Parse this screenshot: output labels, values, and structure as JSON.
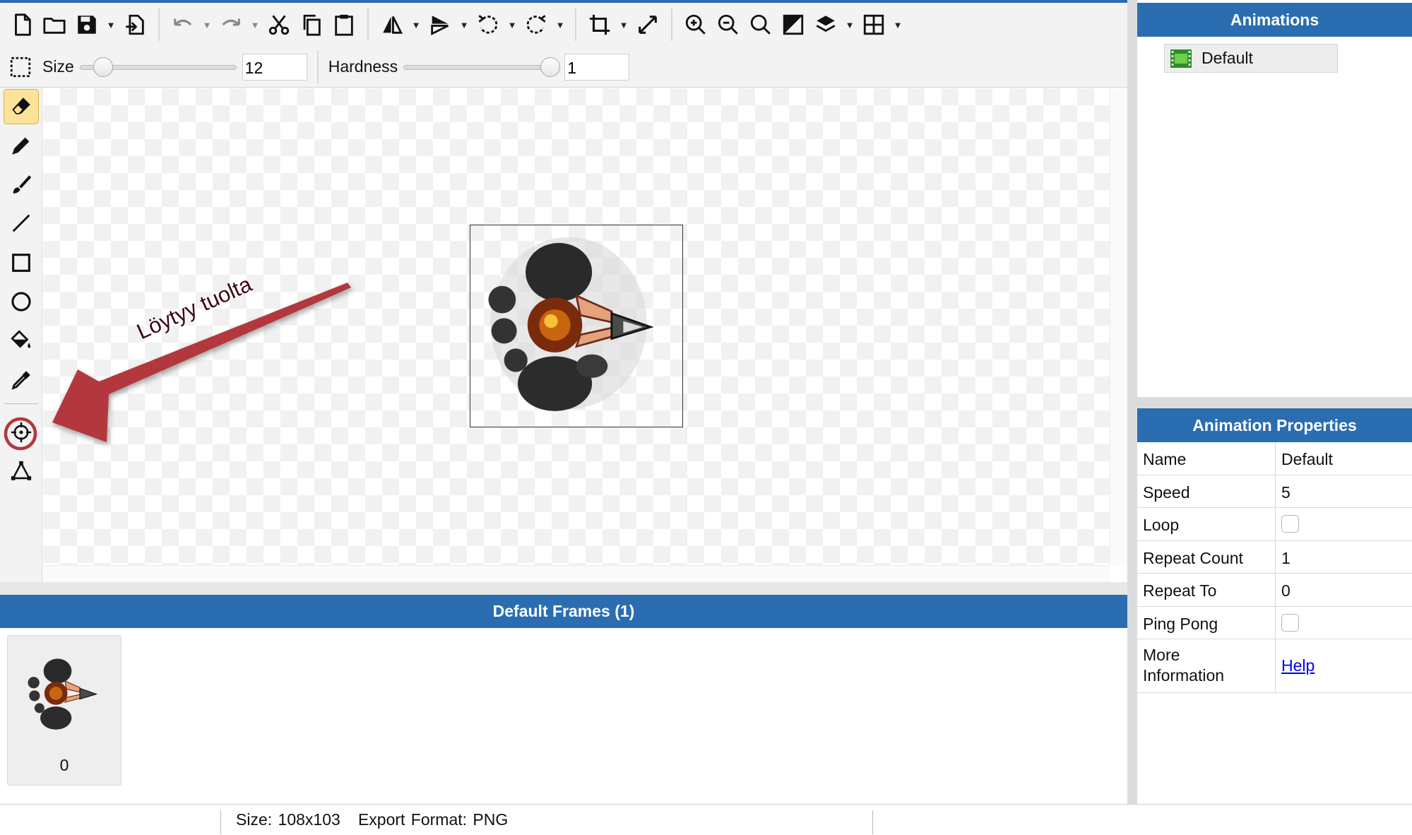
{
  "toolbar": {
    "buttons": [
      "new-file-icon",
      "open-folder-icon",
      "save-icon",
      "export-icon",
      "undo-icon",
      "redo-icon",
      "cut-icon",
      "copy-icon",
      "paste-icon",
      "flip-horizontal-icon",
      "flip-vertical-icon",
      "rotate-left-icon",
      "rotate-right-icon",
      "crop-icon",
      "resize-icon",
      "zoom-in-icon",
      "zoom-out-icon",
      "zoom-fit-icon",
      "contrast-icon",
      "layers-icon",
      "grid-icon"
    ]
  },
  "brush": {
    "size_label": "Size",
    "size_value": "12",
    "size_fraction": 0.1,
    "hardness_label": "Hardness",
    "hardness_value": "1",
    "hardness_fraction": 1.0
  },
  "tools": [
    "eraser-icon",
    "pencil-icon",
    "brush-icon",
    "line-icon",
    "rectangle-icon",
    "ellipse-icon",
    "fill-bucket-icon",
    "eyedropper-icon",
    "origin-point-icon",
    "polygon-points-icon"
  ],
  "active_tool": "eraser-icon",
  "annotation": {
    "text": "Löytyy tuolta",
    "color": "#b3383e"
  },
  "frames": {
    "header": "Default Frames (1)",
    "items": [
      {
        "index": "0"
      }
    ]
  },
  "animations": {
    "header": "Animations",
    "items": [
      {
        "name": "Default"
      }
    ]
  },
  "properties": {
    "header": "Animation Properties",
    "rows": [
      {
        "key": "Name",
        "value": "Default"
      },
      {
        "key": "Speed",
        "value": "5"
      },
      {
        "key": "Loop",
        "checked": false
      },
      {
        "key": "Repeat Count",
        "value": "1"
      },
      {
        "key": "Repeat To",
        "value": "0"
      },
      {
        "key": "Ping Pong",
        "checked": false
      },
      {
        "key_line1": "More",
        "key_line2": "Information",
        "link": "Help"
      }
    ]
  },
  "status": {
    "text": "Size: 108x103   Export Format: PNG"
  },
  "colors": {
    "accent": "#2a6db0",
    "panel": "#f3f3f3",
    "active_tool_bg": "#fce39a"
  }
}
